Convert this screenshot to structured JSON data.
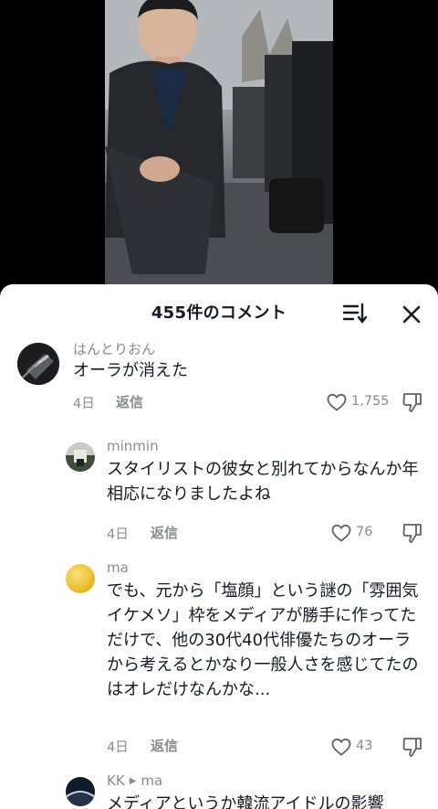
{
  "sheet": {
    "title": "455件のコメント"
  },
  "comments": [
    {
      "username": "はんとりおん",
      "text": "オーラが消えた",
      "date": "4日",
      "reply": "返信",
      "likes": "1,755"
    },
    {
      "username": "minmin",
      "text": "スタイリストの彼女と別れてからなんか年相応になりましたよね",
      "date": "4日",
      "reply": "返信",
      "likes": "76"
    },
    {
      "username": "ma",
      "text": "でも、元から「塩顔」という謎の「雰囲気イケメソ」枠をメディアが勝手に作ってただけで、他の30代40代俳優たちのオーラから考えるとかなり一般人さを感じてたのはオレだけなんかな...",
      "date": "4日",
      "reply": "返信",
      "likes": "43"
    },
    {
      "username": "KK",
      "reply_to": "ma",
      "text": "メディアというか韓流アイドルの影響"
    }
  ],
  "colors": {
    "text": "#161823",
    "secondary": "#8a8b91",
    "sheet_bg": "#ffffff",
    "backdrop": "#000000"
  }
}
